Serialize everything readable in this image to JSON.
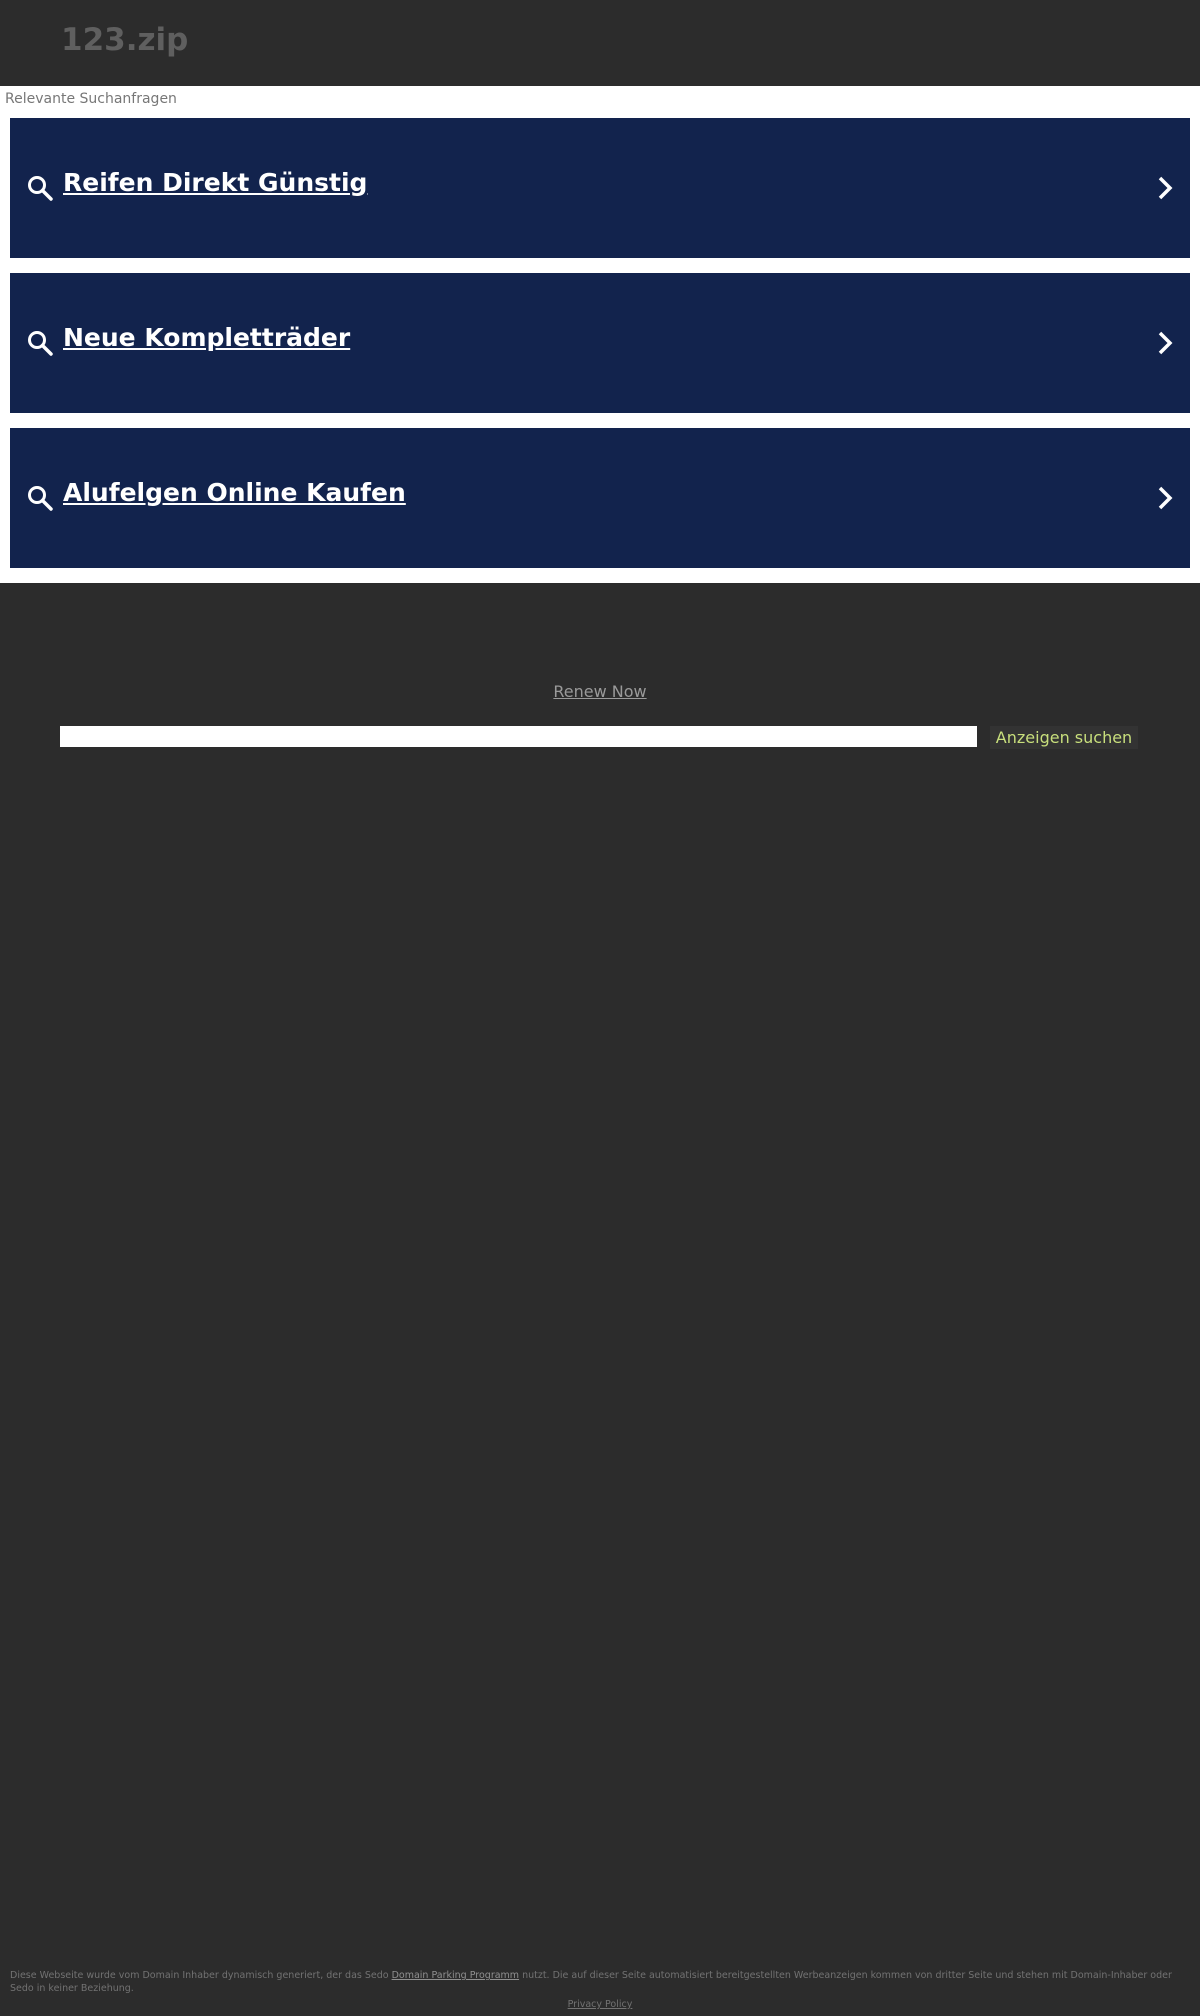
{
  "header": {
    "domain_title": "123.zip"
  },
  "results": {
    "label": "Relevante Suchanfragen",
    "items": [
      {
        "label": "Reifen Direkt Günstig"
      },
      {
        "label": "Neue Kompletträder"
      },
      {
        "label": "Alufelgen Online Kaufen"
      }
    ]
  },
  "renew": {
    "label": "Renew Now"
  },
  "search": {
    "input_value": "",
    "button_label": "Anzeigen suchen"
  },
  "footer": {
    "disclaimer_before": "Diese Webseite wurde vom Domain Inhaber dynamisch generiert, der das Sedo ",
    "disclaimer_link": "Domain Parking Programm",
    "disclaimer_after": " nutzt. Die auf dieser Seite automatisiert bereitgestellten Werbeanzeigen kommen von dritter Seite und stehen mit Domain-Inhaber oder Sedo in keiner Beziehung.",
    "privacy_label": "Privacy Policy"
  },
  "colors": {
    "background": "#2c2c2c",
    "result_background": "#12234d",
    "button_text": "#c8df7c"
  },
  "icons": {
    "result_search": "search-icon",
    "result_arrow": "chevron-right-icon"
  }
}
